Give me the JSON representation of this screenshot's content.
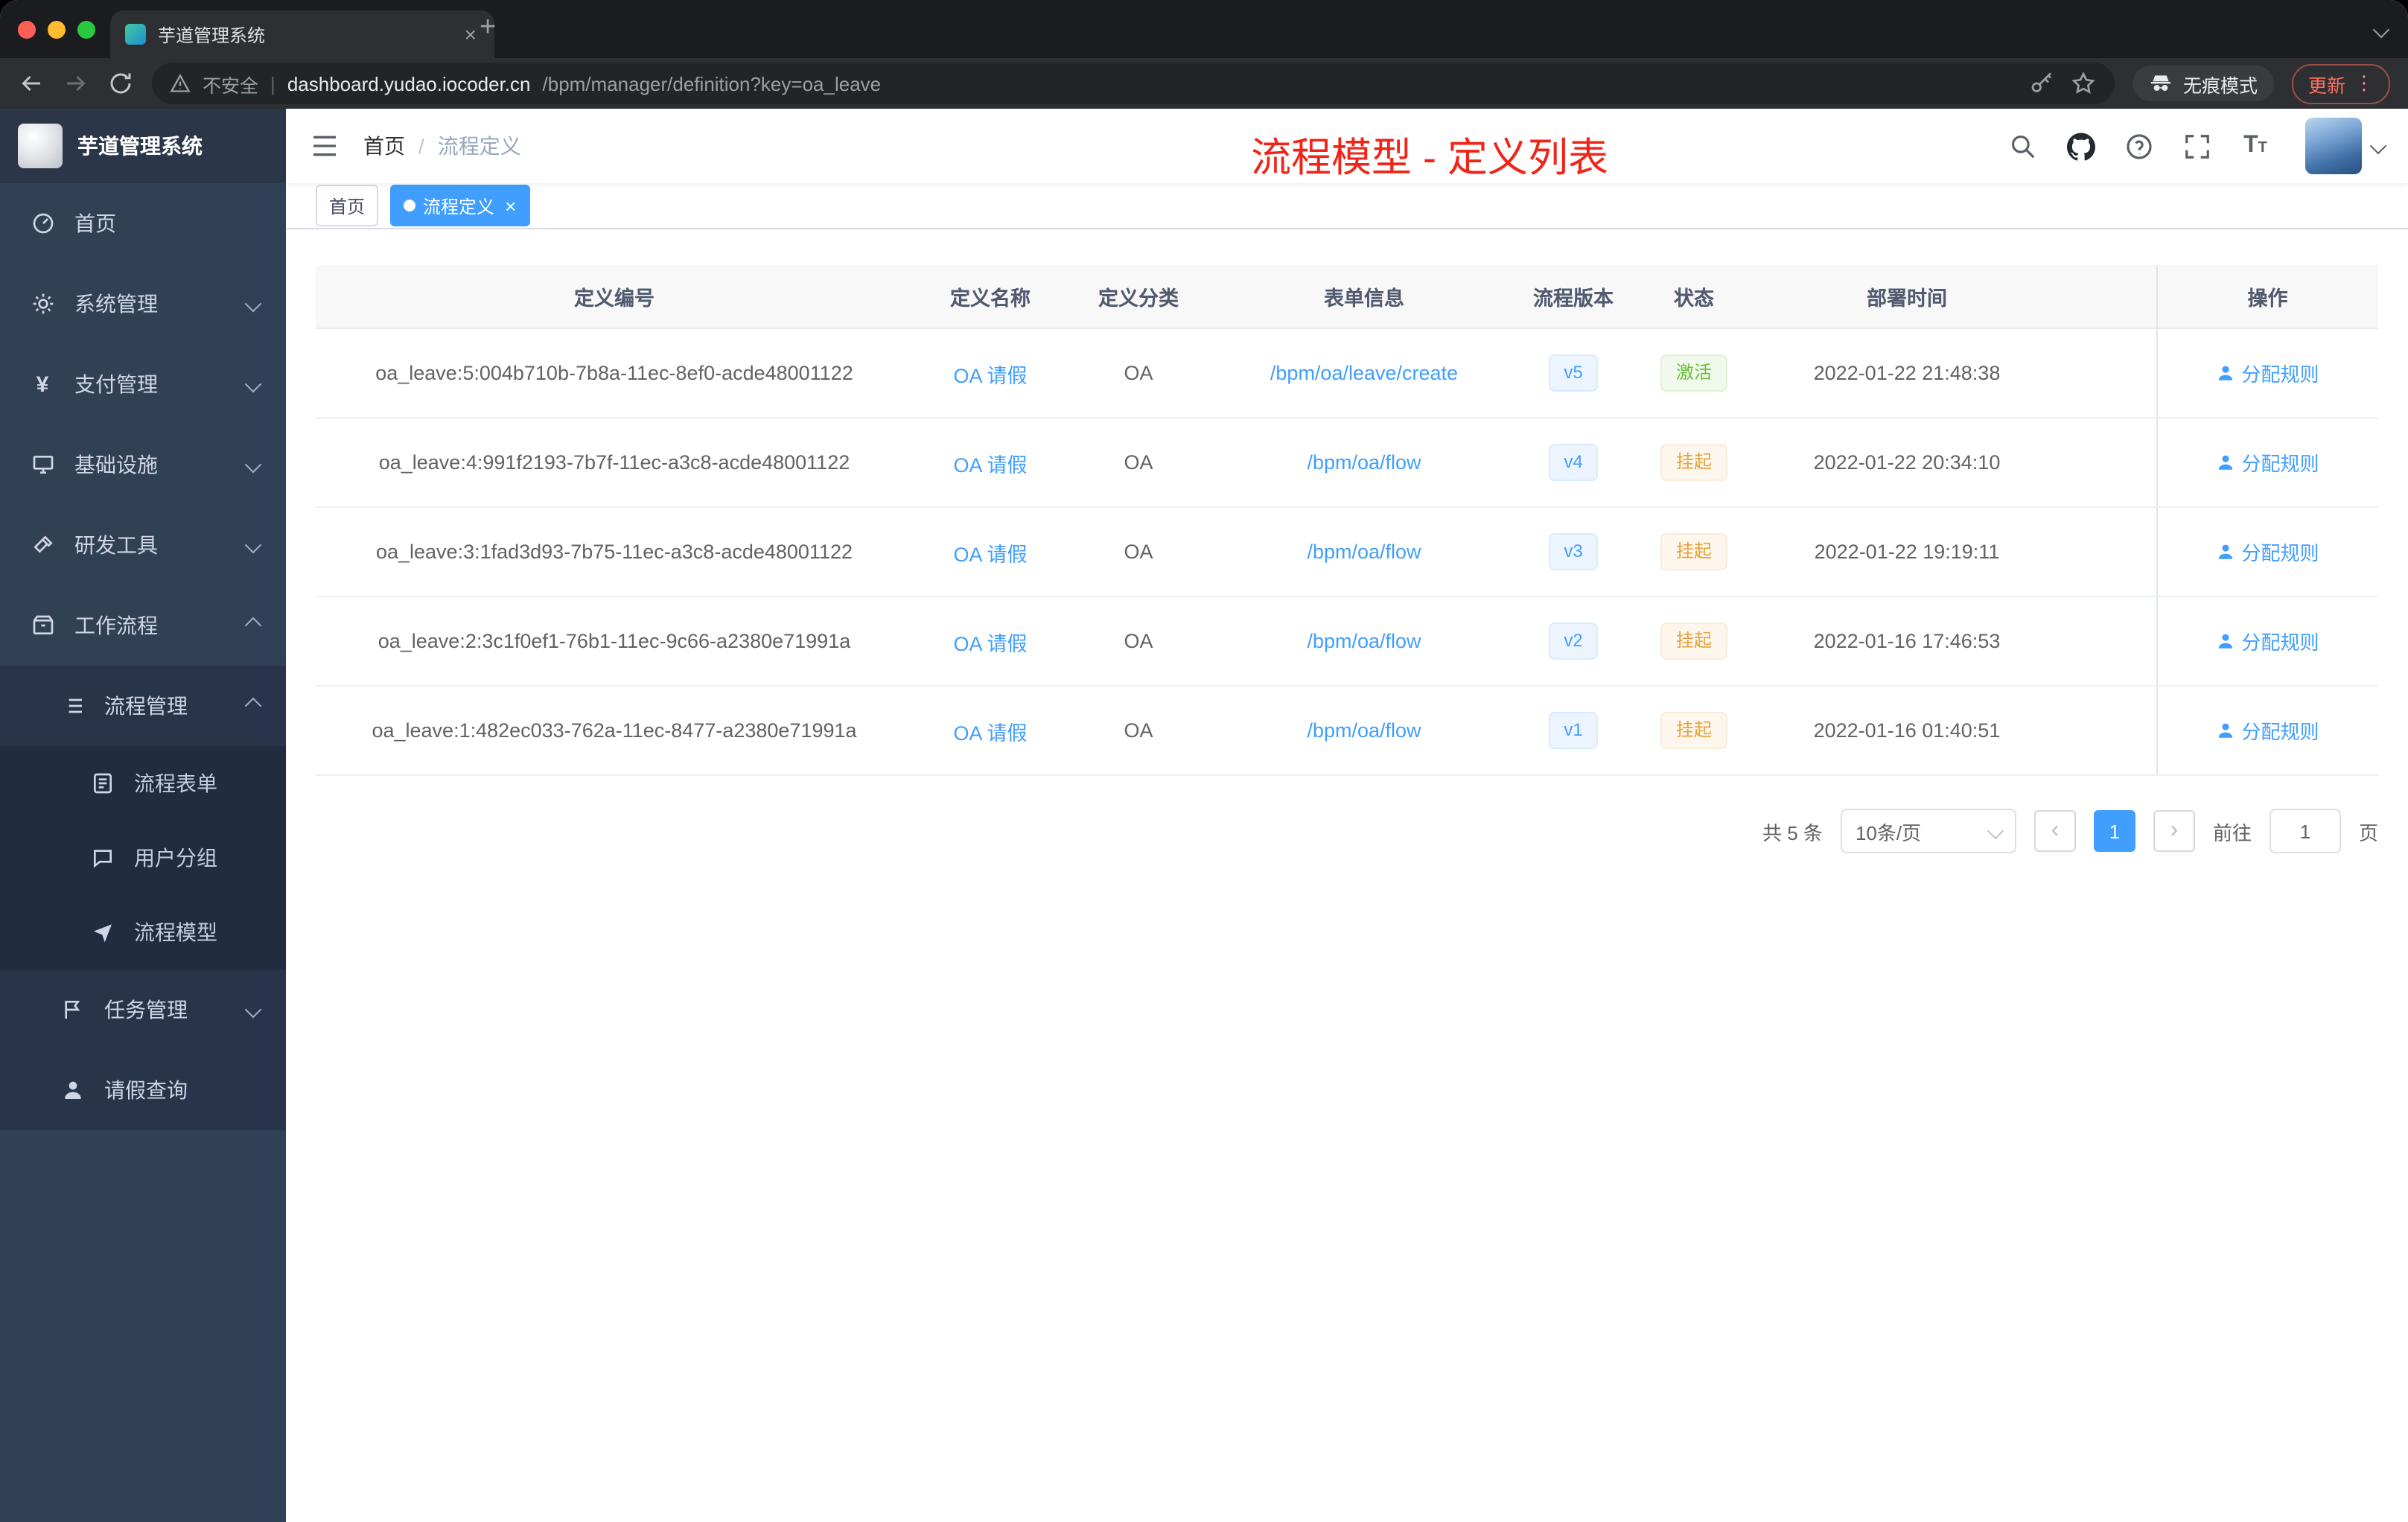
{
  "browser": {
    "tab_title": "芋道管理系统",
    "security_label": "不安全",
    "url_host": "dashboard.yudao.iocoder.cn",
    "url_path": "/bpm/manager/definition?key=oa_leave",
    "incognito_label": "无痕模式",
    "update_label": "更新"
  },
  "sidebar": {
    "logo_title": "芋道管理系统",
    "items": [
      {
        "label": "首页",
        "icon": "dashboard",
        "depth": 0
      },
      {
        "label": "系统管理",
        "icon": "gear",
        "depth": 0,
        "chevron": "down"
      },
      {
        "label": "支付管理",
        "icon": "yen",
        "depth": 0,
        "chevron": "down"
      },
      {
        "label": "基础设施",
        "icon": "monitor",
        "depth": 0,
        "chevron": "down"
      },
      {
        "label": "研发工具",
        "icon": "tool",
        "depth": 0,
        "chevron": "down"
      },
      {
        "label": "工作流程",
        "icon": "archive",
        "depth": 0,
        "chevron": "up"
      },
      {
        "label": "流程管理",
        "icon": "list",
        "depth": 1,
        "chevron": "up"
      },
      {
        "label": "流程表单",
        "icon": "form",
        "depth": 2
      },
      {
        "label": "用户分组",
        "icon": "chat",
        "depth": 2
      },
      {
        "label": "流程模型",
        "icon": "send",
        "depth": 2
      },
      {
        "label": "任务管理",
        "icon": "flag",
        "depth": 1,
        "chevron": "down"
      },
      {
        "label": "请假查询",
        "icon": "user",
        "depth": 1
      }
    ]
  },
  "header": {
    "breadcrumb": [
      "首页",
      "流程定义"
    ],
    "breadcrumb_separator": "/",
    "annotation": "流程模型 - 定义列表"
  },
  "tags": [
    {
      "label": "首页",
      "active": false
    },
    {
      "label": "流程定义",
      "active": true
    }
  ],
  "table": {
    "columns": [
      "定义编号",
      "定义名称",
      "定义分类",
      "表单信息",
      "流程版本",
      "状态",
      "部署时间",
      "操作"
    ],
    "action_label": "分配规则",
    "rows": [
      {
        "id": "oa_leave:5:004b710b-7b8a-11ec-8ef0-acde48001122",
        "name": "OA 请假",
        "category": "OA",
        "form": "/bpm/oa/leave/create",
        "version": "v5",
        "status": "激活",
        "status_type": "success",
        "deploy_time": "2022-01-22 21:48:38"
      },
      {
        "id": "oa_leave:4:991f2193-7b7f-11ec-a3c8-acde48001122",
        "name": "OA 请假",
        "category": "OA",
        "form": "/bpm/oa/flow",
        "version": "v4",
        "status": "挂起",
        "status_type": "warning",
        "deploy_time": "2022-01-22 20:34:10"
      },
      {
        "id": "oa_leave:3:1fad3d93-7b75-11ec-a3c8-acde48001122",
        "name": "OA 请假",
        "category": "OA",
        "form": "/bpm/oa/flow",
        "version": "v3",
        "status": "挂起",
        "status_type": "warning",
        "deploy_time": "2022-01-22 19:19:11"
      },
      {
        "id": "oa_leave:2:3c1f0ef1-76b1-11ec-9c66-a2380e71991a",
        "name": "OA 请假",
        "category": "OA",
        "form": "/bpm/oa/flow",
        "version": "v2",
        "status": "挂起",
        "status_type": "warning",
        "deploy_time": "2022-01-16 17:46:53"
      },
      {
        "id": "oa_leave:1:482ec033-762a-11ec-8477-a2380e71991a",
        "name": "OA 请假",
        "category": "OA",
        "form": "/bpm/oa/flow",
        "version": "v1",
        "status": "挂起",
        "status_type": "warning",
        "deploy_time": "2022-01-16 01:40:51"
      }
    ]
  },
  "pagination": {
    "total_label": "共 5 条",
    "page_size_label": "10条/页",
    "current_page": "1",
    "goto_label": "前往",
    "goto_value": "1",
    "unit_label": "页"
  },
  "colors": {
    "accent_blue": "#409eff",
    "success_green": "#67c23a",
    "warning_orange": "#e6a23c",
    "annotation_red": "#f0251a",
    "sidebar_bg": "#304156",
    "active_tag_bg": "#409eff"
  }
}
